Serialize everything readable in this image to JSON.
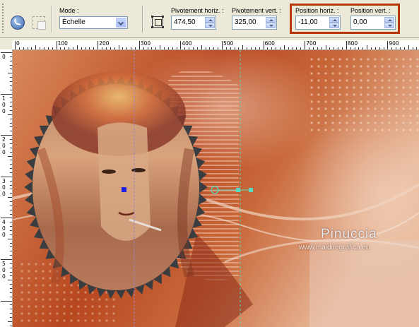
{
  "toolbar": {
    "mode_label": "Mode :",
    "mode_value": "Échelle",
    "pivot_h_label": "Pivotement horiz. :",
    "pivot_h_value": "474,50",
    "pivot_v_label": "Pivotement vert. :",
    "pivot_v_value": "325,00",
    "pos_h_label": "Position horiz. :",
    "pos_h_value": "-11,00",
    "pos_v_label": "Position vert. :",
    "pos_v_value": "0,00"
  },
  "ruler": {
    "top_labels": [
      "0",
      "100",
      "200",
      "300",
      "400",
      "500",
      "600",
      "700",
      "800",
      "900"
    ],
    "left_labels": [
      "0",
      "1\n0\n0",
      "2\n0\n0",
      "3\n0\n0",
      "4\n0\n0",
      "5\n0\n0"
    ]
  },
  "watermark": {
    "name": "Pinuccia",
    "url": "www.maidiregrafica.eu"
  },
  "colors": {
    "highlight": "#b5380c",
    "canvas_main": "#c25a2c"
  }
}
